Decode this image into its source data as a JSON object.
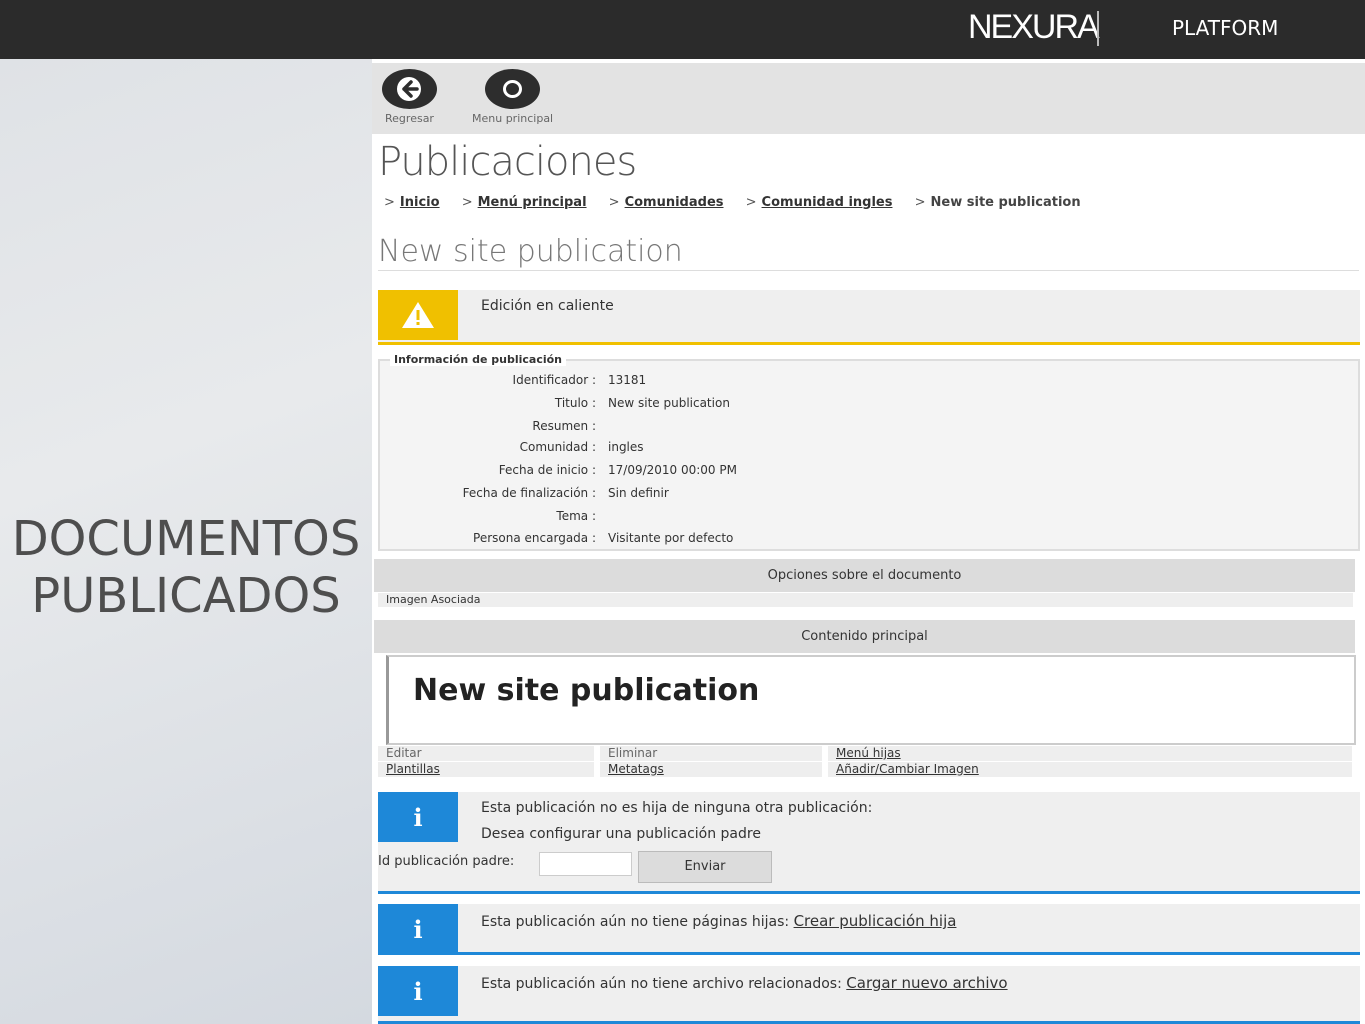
{
  "header": {
    "brand": "NEXURA",
    "platform": "PLATFORM"
  },
  "left": {
    "title_line1": "DOCUMENTOS",
    "title_line2": "PUBLICADOS"
  },
  "toolbar": {
    "back_label": "Regresar",
    "menu_label": "Menu principal"
  },
  "page_title": "Publicaciones",
  "breadcrumb": [
    {
      "label": "Inicio"
    },
    {
      "label": "Menú principal"
    },
    {
      "label": "Comunidades"
    },
    {
      "label": "Comunidad ingles"
    },
    {
      "label": "New site publication"
    }
  ],
  "section_title": "New site publication",
  "warning": {
    "message": "Edición en caliente"
  },
  "info_panel": {
    "legend": "Información de publicación",
    "fields": [
      {
        "key": "Identificador :",
        "value": "13181"
      },
      {
        "key": "Titulo :",
        "value": "New site publication"
      },
      {
        "key": "Resumen :",
        "value": ""
      },
      {
        "key": "Comunidad :",
        "value": "ingles"
      },
      {
        "key": "Fecha de inicio :",
        "value": "17/09/2010 00:00 PM"
      },
      {
        "key": "Fecha de finalización :",
        "value": "Sin definir"
      },
      {
        "key": "Tema :",
        "value": ""
      },
      {
        "key": "Persona encargada :",
        "value": "Visitante por defecto"
      }
    ]
  },
  "options_bar": "Opciones sobre el documento",
  "image_row": "Imagen Asociada",
  "content_bar": "Contenido principal",
  "content_heading": "New site publication",
  "actions": {
    "edit": "Editar",
    "delete": "Eliminar",
    "child_menu": "Menú hijas",
    "templates": "Plantillas",
    "metatags": "Metatags",
    "image": "Añadir/Cambiar Imagen"
  },
  "parent_info": {
    "line1": "Esta publicación no es hija de ninguna otra publicación:",
    "line2": "Desea configurar una publicación padre",
    "field_label": "Id publicación padre:",
    "field_value": "",
    "submit": "Enviar"
  },
  "children_info": {
    "message": "Esta publicación aún no tiene páginas hijas:",
    "link": "Crear publicación hija"
  },
  "files_info": {
    "message": "Esta publicación aún no tiene archivo relacionados:",
    "link": "Cargar nuevo archivo"
  },
  "colors": {
    "warning": "#f0c000",
    "info": "#1e88d8",
    "topbar": "#2b2b2b"
  }
}
